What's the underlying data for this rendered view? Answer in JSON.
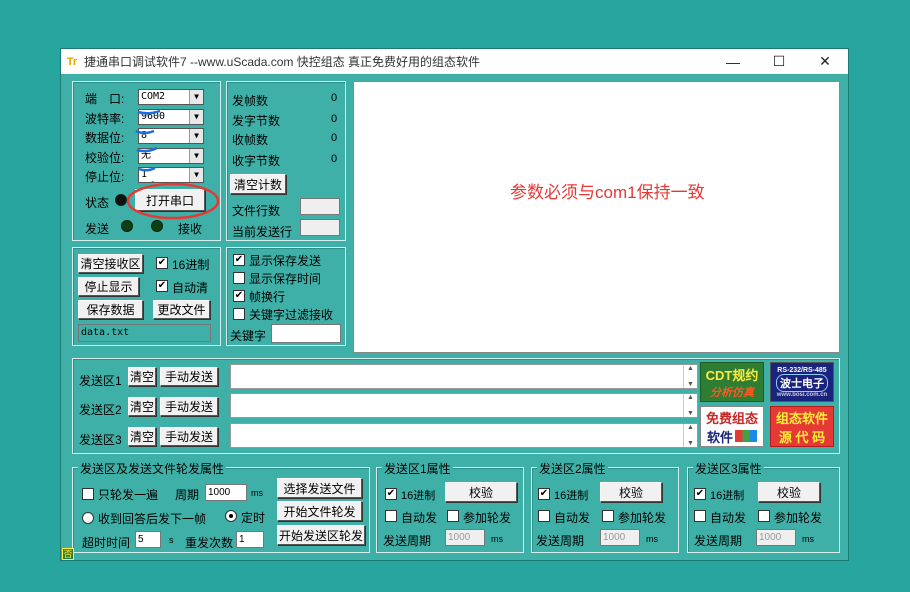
{
  "window": {
    "title": "捷通串口调试软件7  --www.uScada.com   快控组态  真正免费好用的组态软件",
    "min": "—",
    "max": "☐",
    "close": "✕"
  },
  "serial": {
    "port_label": "端　口:",
    "port": "COM2",
    "baud_label": "波特率:",
    "baud": "9600",
    "databits_label": "数据位:",
    "databits": "8",
    "parity_label": "校验位:",
    "parity": "无",
    "stopbits_label": "停止位:",
    "stopbits": "1",
    "status_label": "状态",
    "open_button": "打开串口",
    "send_label": "发送",
    "recv_label": "接收"
  },
  "stats": {
    "frames_sent_label": "发帧数",
    "frames_sent": "0",
    "bytes_sent_label": "发字节数",
    "bytes_sent": "0",
    "frames_recv_label": "收帧数",
    "frames_recv": "0",
    "bytes_recv_label": "收字节数",
    "bytes_recv": "0",
    "clear_button": "清空计数",
    "file_lines_label": "文件行数",
    "current_line_label": "当前发送行"
  },
  "annotation": "参数必须与com1保持一致",
  "recv": {
    "clear_button": "清空接收区",
    "hex_label": "16进制",
    "stop_button": "停止显示",
    "autoclear_label": "自动清",
    "save_button": "保存数据",
    "change_file_button": "更改文件",
    "filename": "data.txt"
  },
  "display": {
    "show_send_label": "显示保存发送",
    "show_time_label": "显示保存时间",
    "newline_label": "帧换行",
    "keyword_filter_label": "关键字过滤接收",
    "keyword_label": "关键字"
  },
  "send_areas": [
    {
      "label": "发送区1",
      "clear": "清空",
      "manual": "手动发送"
    },
    {
      "label": "发送区2",
      "clear": "清空",
      "manual": "手动发送"
    },
    {
      "label": "发送区3",
      "clear": "清空",
      "manual": "手动发送"
    }
  ],
  "logos": {
    "cdt_top": "CDT规约",
    "cdt_bottom": "分析仿真",
    "rs_top": "RS-232/RS-485",
    "rs_mid": "波士电子",
    "rs_bot": "www.bosi.com.cn",
    "free_top": "免费组态",
    "free_bottom": "软件",
    "src_top": "组态软件",
    "src_bottom": "源 代 码"
  },
  "poll": {
    "group_title": "发送区及发送文件轮发属性",
    "only_poll_label": "只轮发一遍",
    "period_label": "周期",
    "period": "1000",
    "ms": "ms",
    "select_file_button": "选择发送文件",
    "on_reply_label": "收到回答后发下一帧",
    "timed_label": "定时",
    "start_file_button": "开始文件轮发",
    "timeout_label": "超时时间",
    "timeout": "5",
    "s": "s",
    "repeat_label": "重发次数",
    "repeat": "1",
    "start_area_button": "开始发送区轮发"
  },
  "area_props": [
    {
      "title": "发送区1属性",
      "hex": "16进制",
      "check": "校验",
      "auto": "自动发",
      "join": "参加轮发",
      "period_label": "发送周期",
      "period": "1000",
      "ms": "ms"
    },
    {
      "title": "发送区2属性",
      "hex": "16进制",
      "check": "校验",
      "auto": "自动发",
      "join": "参加轮发",
      "period_label": "发送周期",
      "period": "1000",
      "ms": "ms"
    },
    {
      "title": "发送区3属性",
      "hex": "16进制",
      "check": "校验",
      "auto": "自动发",
      "join": "参加轮发",
      "period_label": "发送周期",
      "period": "1000",
      "ms": "ms"
    }
  ],
  "statusbar": {
    "icon": "否"
  }
}
